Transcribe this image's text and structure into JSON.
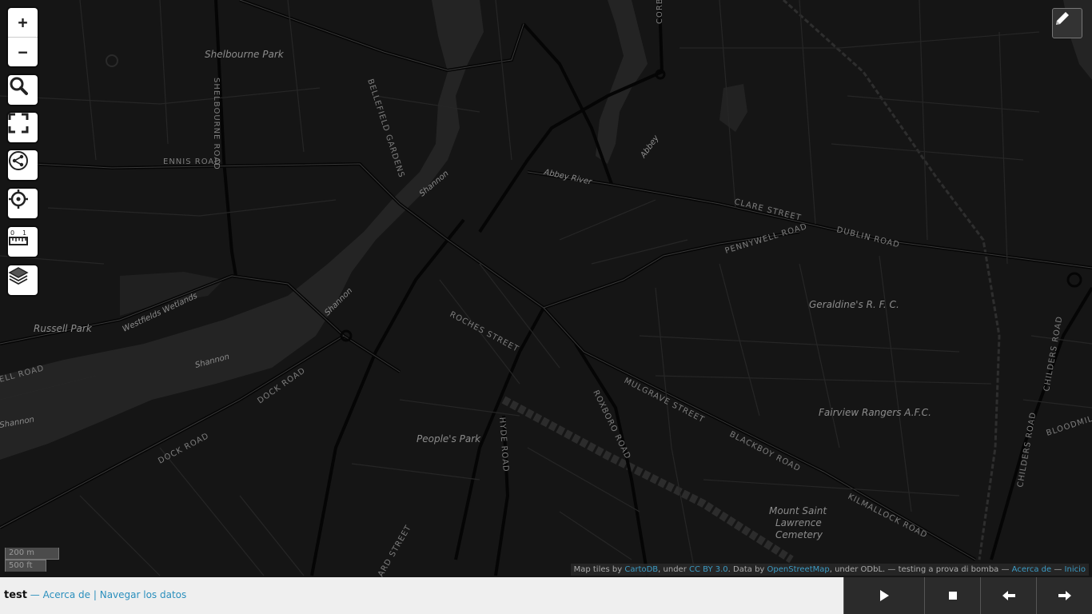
{
  "map": {
    "zoom_in_label": "+",
    "zoom_out_label": "−",
    "place_labels": [
      "Shelbourne Park",
      "Russell Park",
      "Westfields Wetlands",
      "People's Park",
      "Geraldine's R. F. C.",
      "Fairview Rangers A.F.C.",
      "Mount Saint",
      "Lawrence",
      "Cemetery",
      "Abbey River",
      "Abbey",
      "Shannon",
      "Shannon",
      "Shannon",
      "Shannon"
    ],
    "road_labels": [
      "SHELBOURNE ROAD",
      "BELLEFIELD GARDENS",
      "ENNIS ROAD",
      "CLARE STREET",
      "DUBLIN ROAD",
      "PENNYWELL ROAD",
      "ROCHES STREET",
      "DOCK ROAD",
      "DOCK ROAD",
      "HYDE ROAD",
      "ROXBORO ROAD",
      "MULGRAVE STREET",
      "BLACKBOY ROAD",
      "KILMALLOCK ROAD",
      "CHILDERS ROAD",
      "CHILDERS ROAD",
      "BLOODMILL",
      "ELL ROAD",
      "ARD STREET",
      "CORB"
    ]
  },
  "scale": {
    "metric": "200 m",
    "imperial": "500 ft"
  },
  "attribution": {
    "prefix": "Map tiles by ",
    "cartodb": "CartoDB",
    "under1": ", under ",
    "ccby": "CC BY 3.0",
    "data_by": ". Data by ",
    "osm": "OpenStreetMap",
    "under2": ", under ODbL. — testing a prova di bomba — ",
    "about": "Acerca de",
    "dash": " — ",
    "home": "Inicio"
  },
  "footer": {
    "title": "test",
    "sep1": " — ",
    "about_link": "Acerca de",
    "sep2": " | ",
    "browse_link": "Navegar los datos"
  }
}
